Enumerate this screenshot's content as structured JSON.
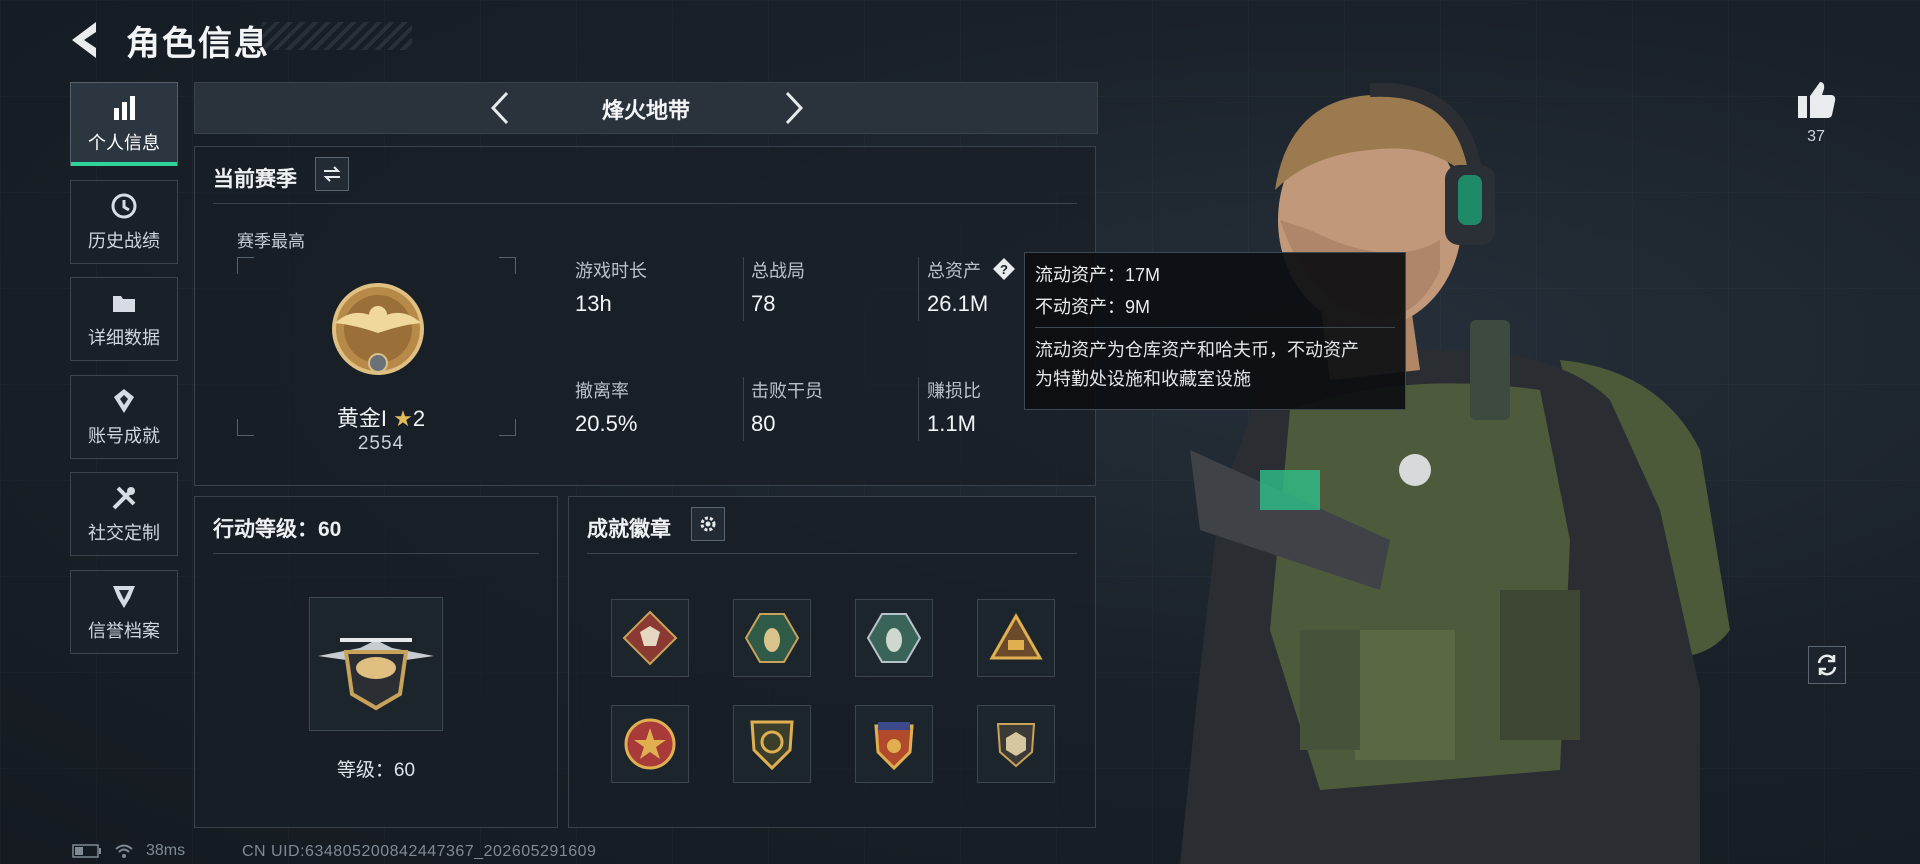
{
  "header": {
    "title": "角色信息"
  },
  "sidebar": {
    "items": [
      {
        "label": "个人信息",
        "icon": "bar-chart-icon",
        "active": true
      },
      {
        "label": "历史战绩",
        "icon": "history-icon"
      },
      {
        "label": "详细数据",
        "icon": "folder-icon"
      },
      {
        "label": "账号成就",
        "icon": "achievement-icon"
      },
      {
        "label": "社交定制",
        "icon": "tools-icon"
      },
      {
        "label": "信誉档案",
        "icon": "shield-icon"
      }
    ]
  },
  "mode": {
    "title": "烽火地带"
  },
  "season": {
    "title": "当前赛季",
    "best_label": "赛季最高",
    "rank_name": "黄金I",
    "rank_stars": "2",
    "rank_points": "2554",
    "stats": [
      {
        "label": "游戏时长",
        "value": "13h"
      },
      {
        "label": "总战局",
        "value": "78"
      },
      {
        "label": "总资产",
        "value": "26.1M"
      },
      {
        "label": "撤离率",
        "value": "20.5%"
      },
      {
        "label": "击败干员",
        "value": "80"
      },
      {
        "label": "赚损比",
        "value": "1.1M"
      }
    ]
  },
  "tooltip": {
    "liquid": "流动资产：17M",
    "fixed": "不动资产：9M",
    "desc_line1": "流动资产为仓库资产和哈夫币，不动资产",
    "desc_line2": "为特勤处设施和收藏室设施"
  },
  "action_level": {
    "title": "行动等级：60",
    "level_text": "等级：60"
  },
  "achievements": {
    "title": "成就徽章"
  },
  "status": {
    "ping": "38ms",
    "uid": "CN UID:634805200842447367_202605291609"
  },
  "likes": {
    "count": "37"
  },
  "colors": {
    "accent": "#2fd49b",
    "panel": "#1f272f",
    "gold": "#c9a25a"
  }
}
